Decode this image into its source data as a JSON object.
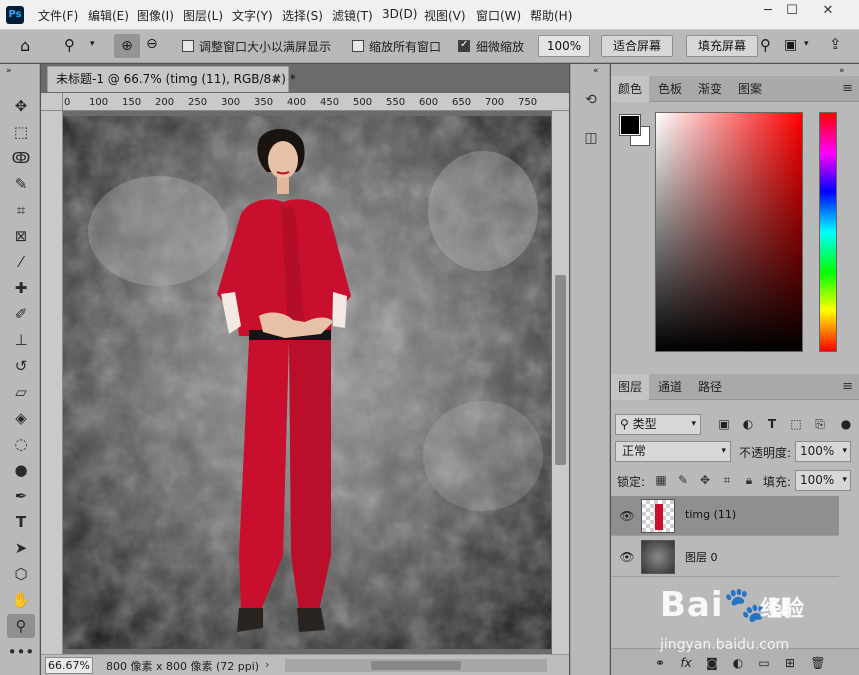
{
  "menubar": {
    "logo": "Ps",
    "items": [
      "文件(F)",
      "编辑(E)",
      "图像(I)",
      "图层(L)",
      "文字(Y)",
      "选择(S)",
      "滤镜(T)",
      "3D(D)",
      "视图(V)",
      "窗口(W)",
      "帮助(H)"
    ],
    "minimize": "─",
    "maximize": "☐",
    "close": "✕"
  },
  "options": {
    "resize_windows_label": "调整窗口大小以满屏显示",
    "resize_windows_checked": false,
    "zoom_all_label": "缩放所有窗口",
    "zoom_all_checked": false,
    "scrubby_zoom_label": "细微缩放",
    "scrubby_zoom_checked": true,
    "zoom_value": "100%",
    "fit_screen_label": "适合屏幕",
    "fill_screen_label": "填充屏幕"
  },
  "document": {
    "tab_title": "未标题-1 @ 66.7% (timg (11), RGB/8#) *",
    "tab_close": "×",
    "ruler_ticks": [
      "0",
      "100",
      "150",
      "200",
      "250",
      "300",
      "350",
      "400",
      "450",
      "500",
      "550",
      "600",
      "650",
      "700",
      "750"
    ],
    "zoom": "66.67%",
    "info": "800 像素 x 800 像素 (72 ppi)",
    "status_arrow": "›"
  },
  "color_panel": {
    "tabs": [
      "颜色",
      "色板",
      "渐变",
      "图案"
    ],
    "active_tab": 0,
    "foreground": "#000000",
    "background": "#ffffff"
  },
  "layers_panel": {
    "tabs": [
      "图层",
      "通道",
      "路径"
    ],
    "active_tab": 0,
    "filter_label": "类型",
    "blend_mode": "正常",
    "opacity_label": "不透明度:",
    "opacity_value": "100%",
    "lock_label": "锁定:",
    "fill_label": "填充:",
    "fill_value": "100%",
    "layers": [
      {
        "name": "timg (11)",
        "selected": true
      },
      {
        "name": "图层 0",
        "selected": false
      }
    ]
  },
  "watermark": {
    "logo": "Bai🐾u",
    "text": "经验",
    "url": "jingyan.baidu.com"
  },
  "colors": {
    "accent": "#31a8ff",
    "outfit": "#c8102e"
  }
}
